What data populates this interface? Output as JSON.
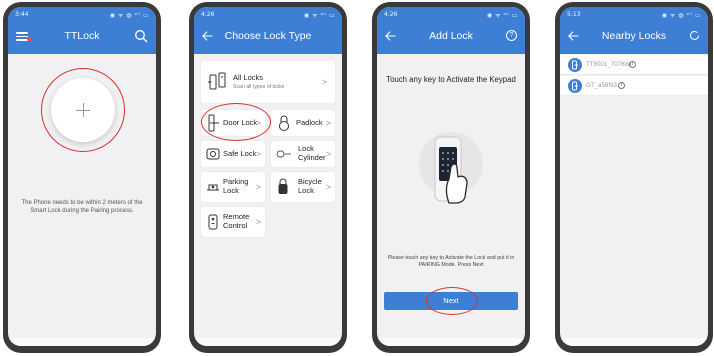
{
  "screen_home": {
    "time": "3:44",
    "status_icons": "◉ ᯤ ◍ ᵒˡˡ ▭",
    "title": "TTLock",
    "pairing_hint": "The Phone needs to be within 2 meters of the Smart Lock during the Pairing process."
  },
  "screen_choose": {
    "time": "4:26",
    "status_icons": "◉ ᯤ ᵒˡˡ ▭",
    "title": "Choose Lock Type",
    "all_locks": {
      "label": "All Locks",
      "sub": "Scan all types of locks"
    },
    "types": [
      {
        "label": "Door Lock"
      },
      {
        "label": "Padlock"
      },
      {
        "label": "Safe Lock"
      },
      {
        "label": "Lock Cylinder",
        "line1": "Lock",
        "line2": "Cylinder"
      },
      {
        "label": "Parking Lock",
        "line1": "Parking",
        "line2": "Lock"
      },
      {
        "label": "Bicycle Lock",
        "line1": "Bicycle",
        "line2": "Lock"
      },
      {
        "label": "Remote Control",
        "line1": "Remote",
        "line2": "Control"
      }
    ],
    "chevron": ">"
  },
  "screen_add": {
    "time": "4:26",
    "status_icons": "◉ ᯤ ᵒˡˡ ▭",
    "title": "Add Lock",
    "help": "?",
    "instruction": "Touch any key to Activate the Keypad",
    "hint": "Please touch any key to Activate the Lock and put it in PAIRING Mode. Press Next",
    "next_label": "Next"
  },
  "screen_nearby": {
    "time": "5:13",
    "status_icons": "◉ ᯤ ◍ ᵒˡˡ ▭",
    "title": "Nearby Locks",
    "locks": [
      {
        "name": "TT8001_7076da"
      },
      {
        "name": "GT_a59f93"
      }
    ],
    "info": "i"
  },
  "colors": {
    "accent": "#3e7fd6",
    "highlight_ring": "#d9302c",
    "background": "#f1f1f3",
    "frame": "#3a3a3a"
  },
  "icons": [
    "menu-icon",
    "search-icon",
    "plus-icon",
    "back-arrow-icon",
    "help-icon",
    "refresh-icon",
    "lock-icon",
    "padlock-icon",
    "safe-icon",
    "cylinder-icon",
    "parking-icon",
    "bicycle-icon",
    "remote-icon",
    "keypad-hand-icon",
    "info-icon"
  ]
}
